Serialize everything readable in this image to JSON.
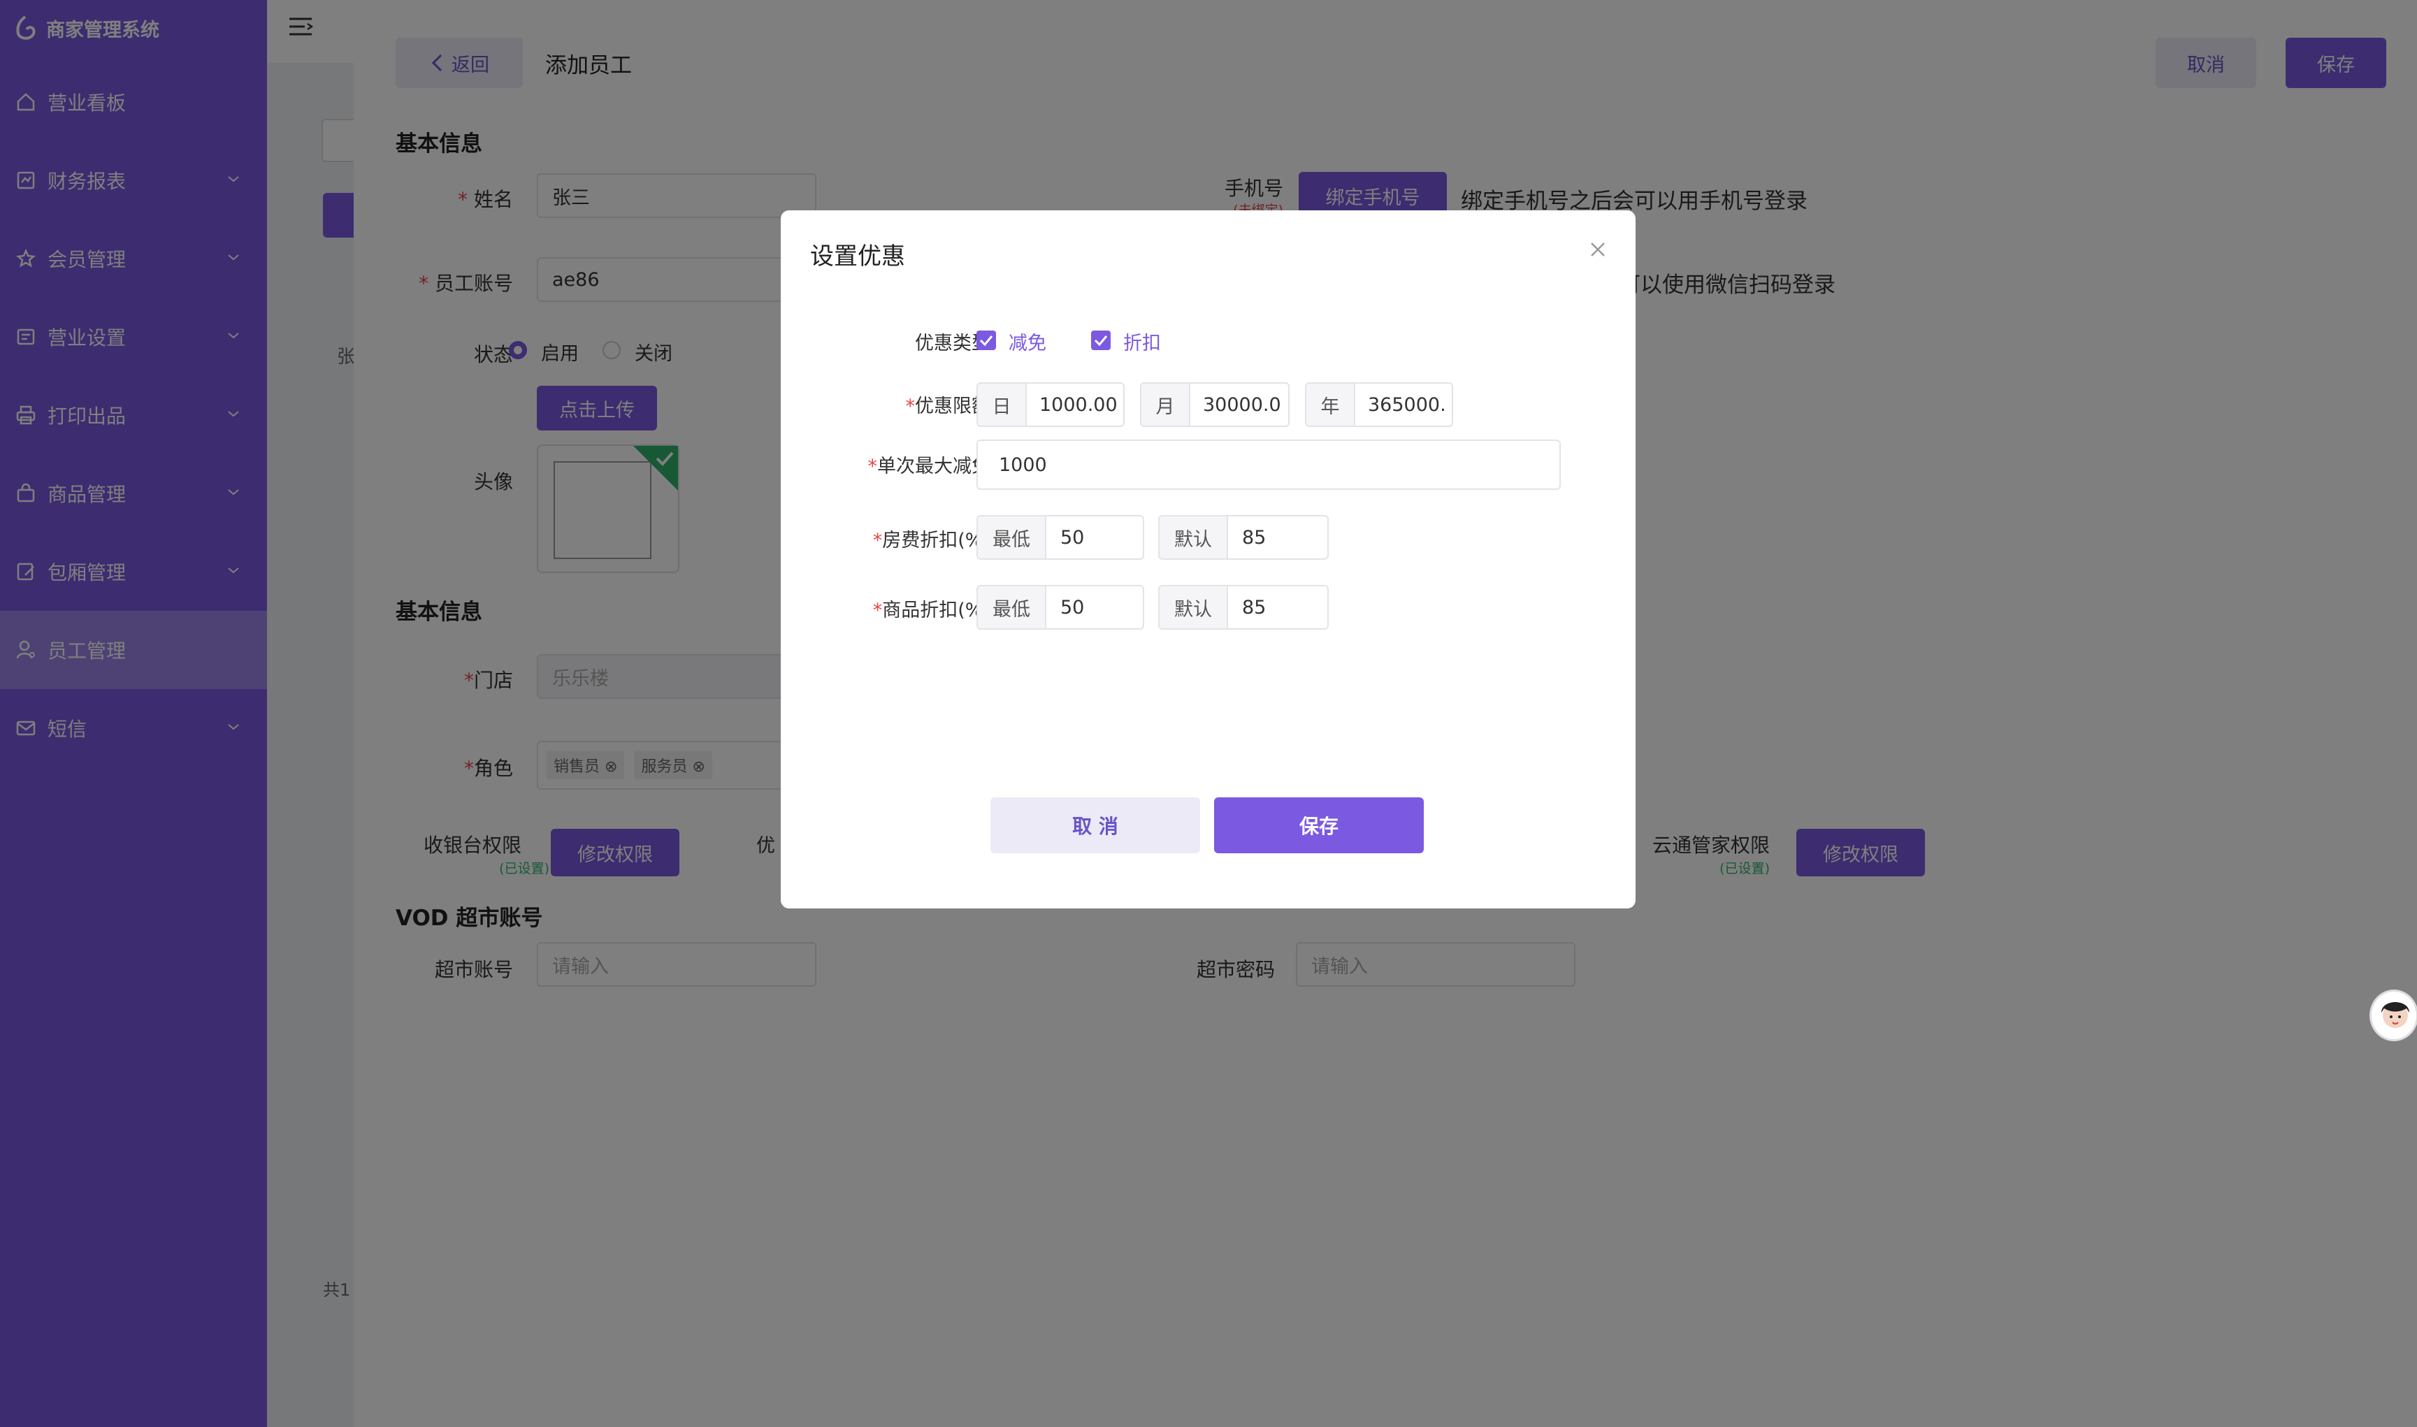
{
  "app": {
    "title": "商家管理系统"
  },
  "sidebar": {
    "items": [
      {
        "label": "营业看板",
        "icon": "home-icon",
        "active": false
      },
      {
        "label": "财务报表",
        "icon": "report-icon",
        "active": false
      },
      {
        "label": "会员管理",
        "icon": "member-icon",
        "active": false
      },
      {
        "label": "营业设置",
        "icon": "settings-icon",
        "active": false
      },
      {
        "label": "打印出品",
        "icon": "printer-icon",
        "active": false
      },
      {
        "label": "商品管理",
        "icon": "bag-icon",
        "active": false
      },
      {
        "label": "包厢管理",
        "icon": "room-icon",
        "active": false
      },
      {
        "label": "员工管理",
        "icon": "staff-icon",
        "active": true
      },
      {
        "label": "短信",
        "icon": "mail-icon",
        "active": false
      }
    ]
  },
  "subside": {
    "partial_chars": [
      "张",
      "共1"
    ]
  },
  "header": {
    "back_label": "返回",
    "page_title": "添加员工",
    "cancel_label": "取消",
    "save_label": "保存"
  },
  "form": {
    "section_basic": "基本信息",
    "name_label": "姓名",
    "name_value": "张三",
    "account_label": "员工账号",
    "account_value": "ae86",
    "status_label": "状态",
    "status_on": "启用",
    "status_off": "关闭",
    "upload_label": "点击上传",
    "avatar_label": "头像",
    "phone_label": "手机号",
    "phone_sub": "(未绑定)",
    "bind_phone_label": "绑定手机号",
    "phone_hint": "绑定手机号之后会可以用手机号登录",
    "wechat_hint": "可以使用微信扫码登录",
    "section_basic2": "基本信息",
    "store_label": "门店",
    "store_value": "乐乐楼",
    "role_label": "角色",
    "roles": [
      "销售员",
      "服务员"
    ],
    "cashier_perm_label": "收银台权限",
    "cashier_perm_sub": "(已设置)",
    "modify_perm_label": "修改权限",
    "discount_perm_partial": "优",
    "cloud_perm_label": "云通管家权限",
    "cloud_perm_sub": "(已设置)",
    "modify_perm_label2": "修改权限",
    "section_vod": "VOD 超市账号",
    "market_account_label": "超市账号",
    "market_account_placeholder": "请输入",
    "market_pwd_label": "超市密码",
    "market_pwd_placeholder": "请输入"
  },
  "modal": {
    "title": "设置优惠",
    "type_label": "优惠类型",
    "type_opt1": "减免",
    "type_opt2": "折扣",
    "limit_label": "优惠限额",
    "day_prefix": "日",
    "day_value": "1000.00",
    "month_prefix": "月",
    "month_value": "30000.0",
    "year_prefix": "年",
    "year_value": "365000.",
    "max_label": "单次最大减免",
    "max_value": "1000",
    "room_label": "房费折扣(%)",
    "room_min_prefix": "最低",
    "room_min_value": "50",
    "room_def_prefix": "默认",
    "room_def_value": "85",
    "goods_label": "商品折扣(%)",
    "goods_min_prefix": "最低",
    "goods_min_value": "50",
    "goods_def_prefix": "默认",
    "goods_def_value": "85",
    "cancel_label": "取 消",
    "save_label": "保存"
  },
  "colors": {
    "accent": "#7b59e0",
    "active_nav": "#9d85e8",
    "required": "#e54545",
    "success": "#2fb36a"
  }
}
